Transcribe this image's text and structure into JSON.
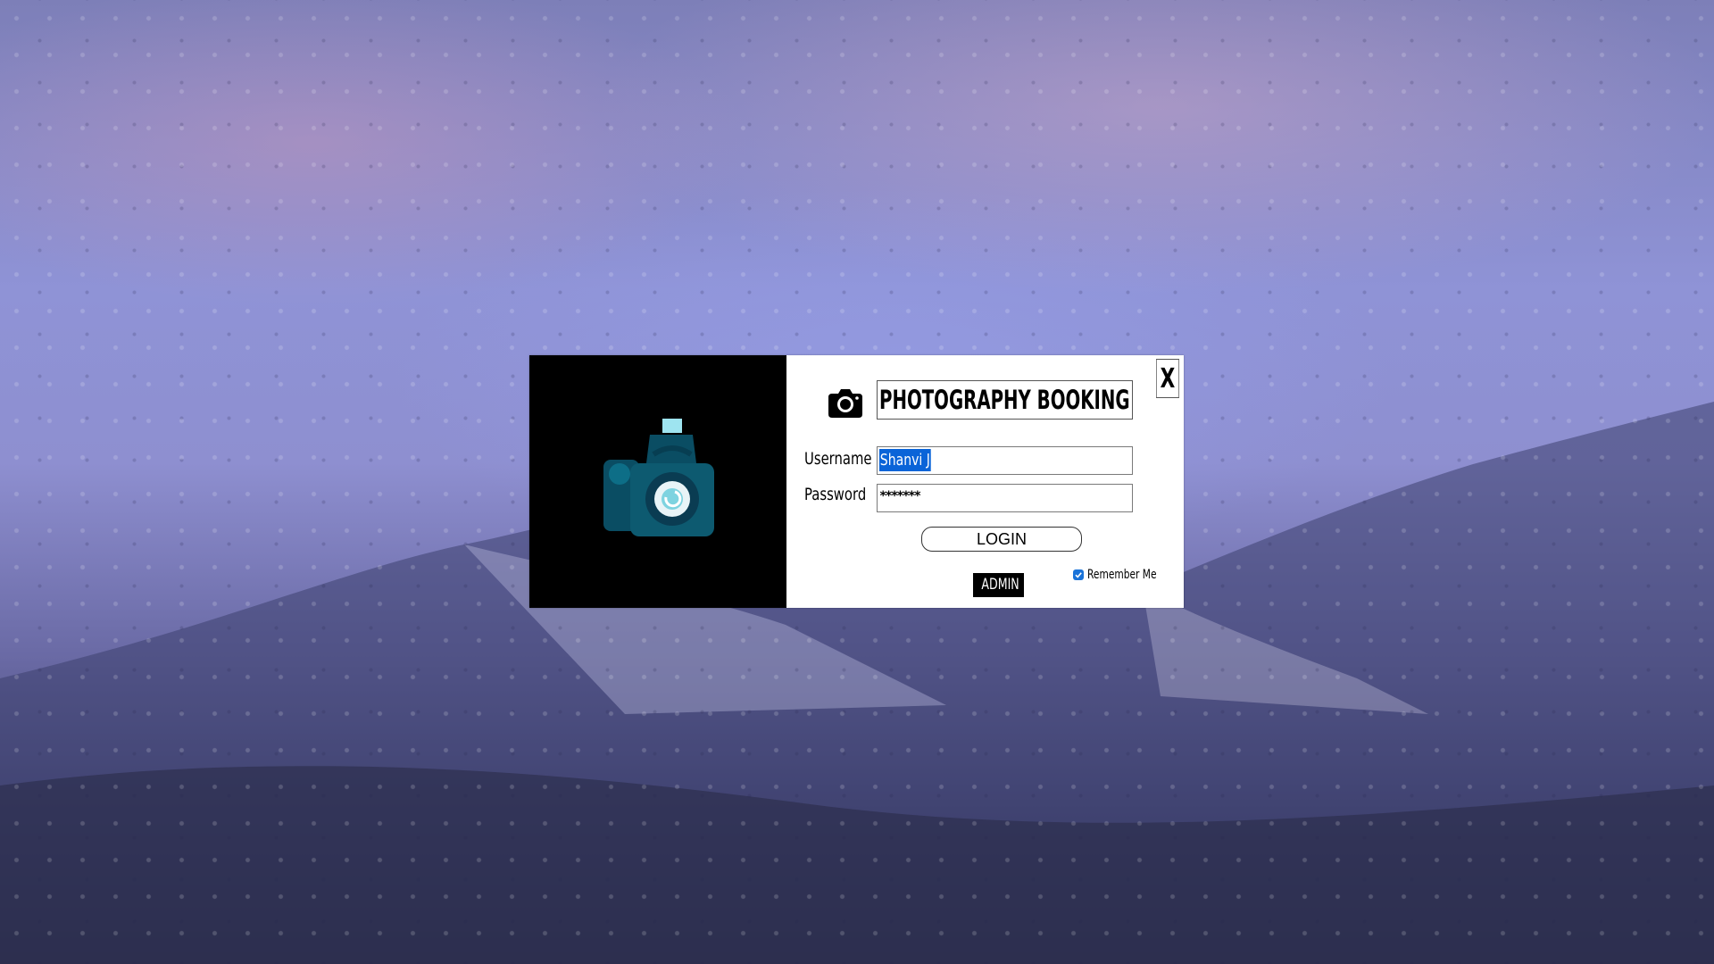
{
  "login_dialog": {
    "title": "PHOTOGRAPHY BOOKING",
    "close_label": "X",
    "username_label": "Username",
    "username_value": "Shanvi J",
    "password_label": "Password",
    "password_value": "*******",
    "login_label": "LOGIN",
    "admin_label": "ADMIN",
    "remember_label": "Remember Me",
    "remember_checked": true
  },
  "icons": {
    "banner": "camera-illustration-icon",
    "title": "camera-icon",
    "checkbox": "check-icon"
  },
  "colors": {
    "banner_bg": "#000000",
    "camera_body": "#0d5a70",
    "camera_dark": "#073e52",
    "camera_flash": "#9ee4f0",
    "selection": "#0a64d8",
    "checkbox": "#1a73d9"
  }
}
